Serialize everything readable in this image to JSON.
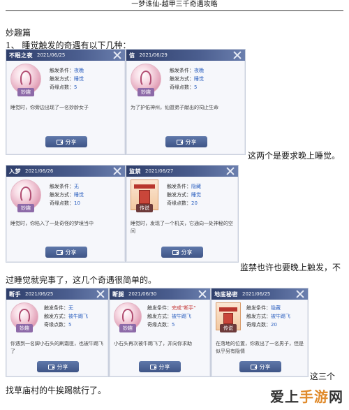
{
  "header": {
    "title": "一梦诛仙-越甲三千奇遇攻略"
  },
  "section": {
    "title": "妙趣篇",
    "item": "1、 睡觉触发的奇遇有以下几种："
  },
  "labels": {
    "cond": "触发条件：",
    "method": "触发方式：",
    "points": "奇缘点数：",
    "share": "分享"
  },
  "cards": [
    {
      "title": "不眠之夜",
      "date": "2021/06/25",
      "cond": "夜晚",
      "method": "睡觉",
      "points": "5",
      "badge": "妙趣",
      "desc": "睡觉时，你旁边出现了一名妙龄女子"
    },
    {
      "title": "信",
      "date": "2021/06/29",
      "cond": "夜晚",
      "method": "睡觉",
      "points": "5",
      "badge": "妙趣",
      "desc": "为了护佑神州，仙盟弟子献出的祠止生命"
    },
    {
      "title": "入梦",
      "date": "2021/06/26",
      "cond": "无",
      "method": "睡觉",
      "points": "10",
      "badge": "妙趣",
      "desc": "睡觉时，你陷入了一处奇怪的梦境当中"
    },
    {
      "title": "监禁",
      "date": "2021/06/27",
      "cond": "隐藏",
      "method": "睡觉",
      "points": "20",
      "badge": "传说",
      "desc": "睡觉时，发现了一个机关，它通向一处神秘的空间"
    },
    {
      "title": "断手",
      "date": "2021/06/25",
      "cond": "无",
      "method": "被牛踢飞",
      "points": "5",
      "badge": "妙趣",
      "desc": "你遇到一名脚小石头的刷霜匪，也被牛踢飞了"
    },
    {
      "title": "断腿",
      "date": "2021/06/30",
      "cond": "完成\"断手\"",
      "method": "被牛踢飞",
      "points": "5",
      "badge": "妙趣",
      "desc": "小石头再次被牛踢飞了，并向你求助"
    },
    {
      "title": "地底秘密",
      "date": "2021/06/25",
      "cond": "隐藏",
      "method": "被牛踢飞",
      "points": "20",
      "badge": "传说",
      "desc": "在落地的位置，你救出了一名男子，但是似乎另有隐情"
    }
  ],
  "notes": {
    "n1": "这两个是要求晚上睡觉。",
    "n2": "监禁也许也要晚上触发，不",
    "n3": "过睡觉就完事了，这几个奇遇很简单的。",
    "n4": "这三个",
    "n5": "找草庙村的牛挨踢就行了。"
  },
  "watermark": {
    "text_a": "爱上",
    "text_b": "手游",
    "text_c": "网"
  }
}
